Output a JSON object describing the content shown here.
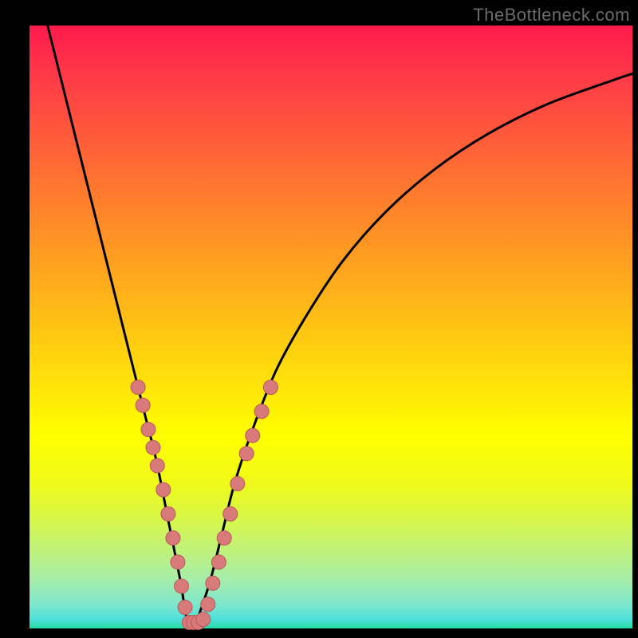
{
  "watermark": "TheBottleneck.com",
  "colors": {
    "background": "#000000",
    "curve": "#000000",
    "marker_fill": "#d87a7a",
    "marker_stroke": "#b85a5a"
  },
  "chart_data": {
    "type": "line",
    "title": "",
    "xlabel": "",
    "ylabel": "",
    "xlim": [
      0,
      100
    ],
    "ylim": [
      0,
      100
    ],
    "series": [
      {
        "name": "bottleneck-curve",
        "description": "V-shaped bottleneck curve with minimum near x≈26",
        "x": [
          3,
          5,
          8,
          11,
          14,
          17,
          19,
          21,
          23,
          25,
          26,
          27,
          28,
          30,
          32,
          34,
          37,
          41,
          46,
          52,
          59,
          67,
          76,
          86,
          97,
          100
        ],
        "y": [
          100,
          92,
          80,
          68,
          56,
          44,
          36,
          28,
          18,
          8,
          2,
          0,
          2,
          8,
          16,
          24,
          33,
          43,
          52,
          61,
          69,
          76,
          82,
          87,
          91,
          92
        ]
      }
    ],
    "markers": {
      "name": "highlighted-points",
      "description": "Salmon circular markers clustered along the lower part of the V",
      "points": [
        {
          "x": 18.0,
          "y": 40
        },
        {
          "x": 18.8,
          "y": 37
        },
        {
          "x": 19.7,
          "y": 33
        },
        {
          "x": 20.5,
          "y": 30
        },
        {
          "x": 21.2,
          "y": 27
        },
        {
          "x": 22.2,
          "y": 23
        },
        {
          "x": 23.0,
          "y": 19
        },
        {
          "x": 23.8,
          "y": 15
        },
        {
          "x": 24.6,
          "y": 11
        },
        {
          "x": 25.2,
          "y": 7
        },
        {
          "x": 25.8,
          "y": 3.5
        },
        {
          "x": 26.5,
          "y": 1
        },
        {
          "x": 27.2,
          "y": 1
        },
        {
          "x": 28.0,
          "y": 1
        },
        {
          "x": 28.8,
          "y": 1.5
        },
        {
          "x": 29.6,
          "y": 4
        },
        {
          "x": 30.4,
          "y": 7.5
        },
        {
          "x": 31.4,
          "y": 11
        },
        {
          "x": 32.3,
          "y": 15
        },
        {
          "x": 33.3,
          "y": 19
        },
        {
          "x": 34.5,
          "y": 24
        },
        {
          "x": 36.0,
          "y": 29
        },
        {
          "x": 37.0,
          "y": 32
        },
        {
          "x": 38.5,
          "y": 36
        },
        {
          "x": 40.0,
          "y": 40
        }
      ]
    }
  }
}
